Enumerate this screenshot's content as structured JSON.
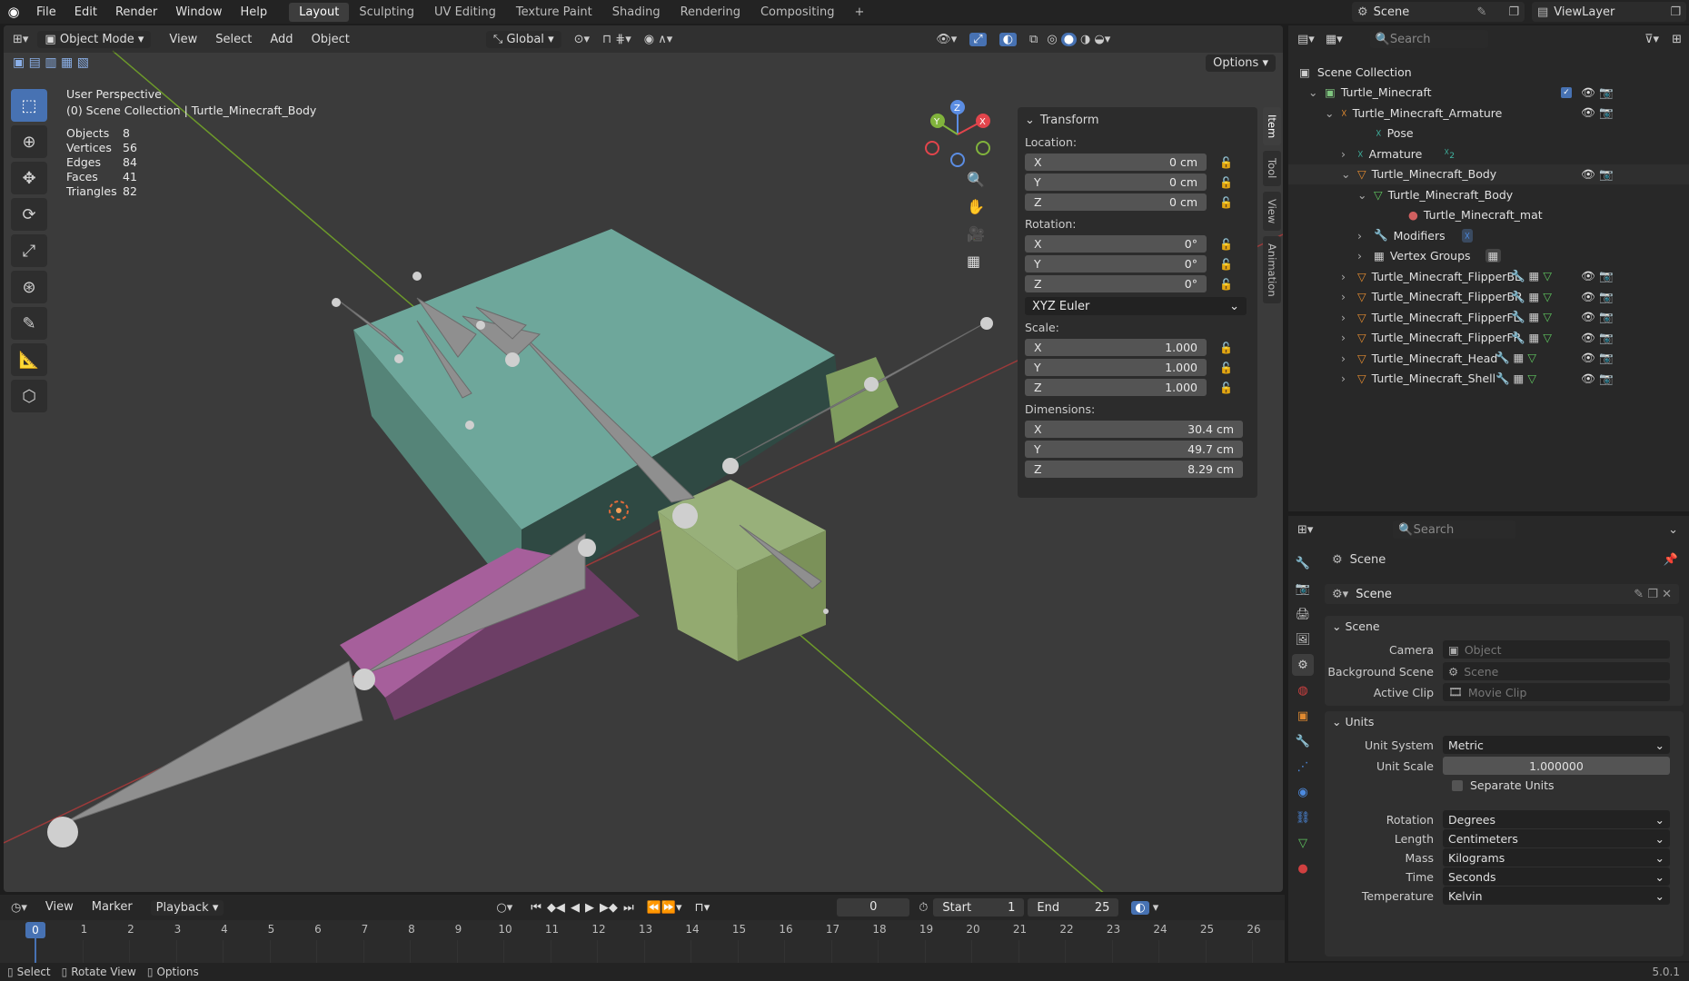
{
  "menubar": {
    "items": [
      "File",
      "Edit",
      "Render",
      "Window",
      "Help"
    ],
    "workspaces": [
      "Layout",
      "Sculpting",
      "UV Editing",
      "Texture Paint",
      "Shading",
      "Rendering",
      "Compositing"
    ],
    "active_workspace": "Layout",
    "add_tab": "+",
    "scene": "Scene",
    "view_layer": "ViewLayer"
  },
  "viewport": {
    "mode": "Object Mode",
    "menus": [
      "View",
      "Select",
      "Add",
      "Object"
    ],
    "orientation": "Global",
    "options": "Options",
    "info_line1": "User Perspective",
    "info_line2": "(0) Scene Collection | Turtle_Minecraft_Body",
    "stats": [
      {
        "label": "Objects",
        "value": "8"
      },
      {
        "label": "Vertices",
        "value": "56"
      },
      {
        "label": "Edges",
        "value": "84"
      },
      {
        "label": "Faces",
        "value": "41"
      },
      {
        "label": "Triangles",
        "value": "82"
      }
    ],
    "gizmo": {
      "x": "X",
      "y": "Y",
      "z": "Z"
    }
  },
  "npanel": {
    "title": "Transform",
    "location_label": "Location:",
    "location": [
      {
        "axis": "X",
        "value": "0 cm"
      },
      {
        "axis": "Y",
        "value": "0 cm"
      },
      {
        "axis": "Z",
        "value": "0 cm"
      }
    ],
    "rotation_label": "Rotation:",
    "rotation": [
      {
        "axis": "X",
        "value": "0°"
      },
      {
        "axis": "Y",
        "value": "0°"
      },
      {
        "axis": "Z",
        "value": "0°"
      }
    ],
    "rotation_mode": "XYZ Euler",
    "scale_label": "Scale:",
    "scale": [
      {
        "axis": "X",
        "value": "1.000"
      },
      {
        "axis": "Y",
        "value": "1.000"
      },
      {
        "axis": "Z",
        "value": "1.000"
      }
    ],
    "dimensions_label": "Dimensions:",
    "dimensions": [
      {
        "axis": "X",
        "value": "30.4 cm"
      },
      {
        "axis": "Y",
        "value": "49.7 cm"
      },
      {
        "axis": "Z",
        "value": "8.29 cm"
      }
    ],
    "tabs": [
      "Item",
      "Tool",
      "View",
      "Animation"
    ]
  },
  "outliner": {
    "search_placeholder": "Search",
    "root": "Scene Collection",
    "rows": [
      "Turtle_Minecraft",
      "Turtle_Minecraft_Armature",
      "Pose",
      "Armature",
      "Turtle_Minecraft_Body",
      "Turtle_Minecraft_Body",
      "Turtle_Minecraft_mat",
      "Modifiers",
      "Vertex Groups",
      "Turtle_Minecraft_FlipperBL",
      "Turtle_Minecraft_FlipperBR",
      "Turtle_Minecraft_FlipperFL",
      "Turtle_Minecraft_FlipperFR",
      "Turtle_Minecraft_Head",
      "Turtle_Minecraft_Shell"
    ],
    "armature_badge": "2"
  },
  "properties": {
    "search_placeholder": "Search",
    "context": "Scene",
    "datablock": "Scene",
    "scene_section": "Scene",
    "camera_label": "Camera",
    "camera_value": "Object",
    "bg_label": "Background Scene",
    "bg_value": "Scene",
    "clip_label": "Active Clip",
    "clip_value": "Movie Clip",
    "units_section": "Units",
    "unit_system_label": "Unit System",
    "unit_system": "Metric",
    "unit_scale_label": "Unit Scale",
    "unit_scale": "1.000000",
    "separate_units": "Separate Units",
    "rotation_label": "Rotation",
    "rotation_value": "Degrees",
    "length_label": "Length",
    "length_value": "Centimeters",
    "mass_label": "Mass",
    "mass_value": "Kilograms",
    "time_label": "Time",
    "time_value": "Seconds",
    "temp_label": "Temperature",
    "temp_value": "Kelvin"
  },
  "timeline": {
    "menus": [
      "View",
      "Marker",
      "Playback"
    ],
    "current_frame": "0",
    "start_label": "Start",
    "start": "1",
    "end_label": "End",
    "end": "25",
    "ruler": [
      "0",
      "1",
      "2",
      "3",
      "4",
      "5",
      "6",
      "7",
      "8",
      "9",
      "10",
      "11",
      "12",
      "13",
      "14",
      "15",
      "16",
      "17",
      "18",
      "19",
      "20",
      "21",
      "22",
      "23",
      "24",
      "25",
      "26"
    ]
  },
  "statusbar": {
    "select": "Select",
    "rotate": "Rotate View",
    "options": "Options",
    "version": "5.0.1"
  }
}
